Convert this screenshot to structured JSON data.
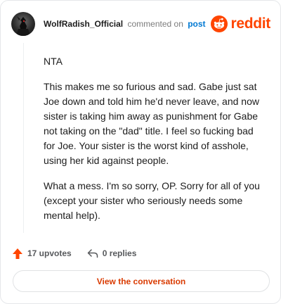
{
  "header": {
    "username": "WolfRadish_Official",
    "commented_text": "commented on",
    "post_link": "post",
    "brand": "reddit"
  },
  "comment": {
    "paragraphs": [
      "NTA",
      "This makes me so furious and sad. Gabe just sat Joe down and told him he'd never leave, and now sister is taking him away as punishment for Gabe not taking on the \"dad\" title. I feel so fucking bad for Joe. Your sister is the worst kind of asshole, using her kid against people.",
      "What a mess. I'm so sorry, OP. Sorry for all of you (except your sister who seriously needs some mental help)."
    ]
  },
  "actions": {
    "upvotes": "17 upvotes",
    "replies": "0 replies"
  },
  "cta": {
    "label": "View the conversation"
  },
  "colors": {
    "brand": "#ff4500",
    "link": "#0079d3",
    "cta_text": "#d93a00"
  },
  "icons": {
    "upvote": "upvote-arrow-icon",
    "reply": "reply-arrow-icon",
    "logo": "reddit-snoo-icon"
  }
}
